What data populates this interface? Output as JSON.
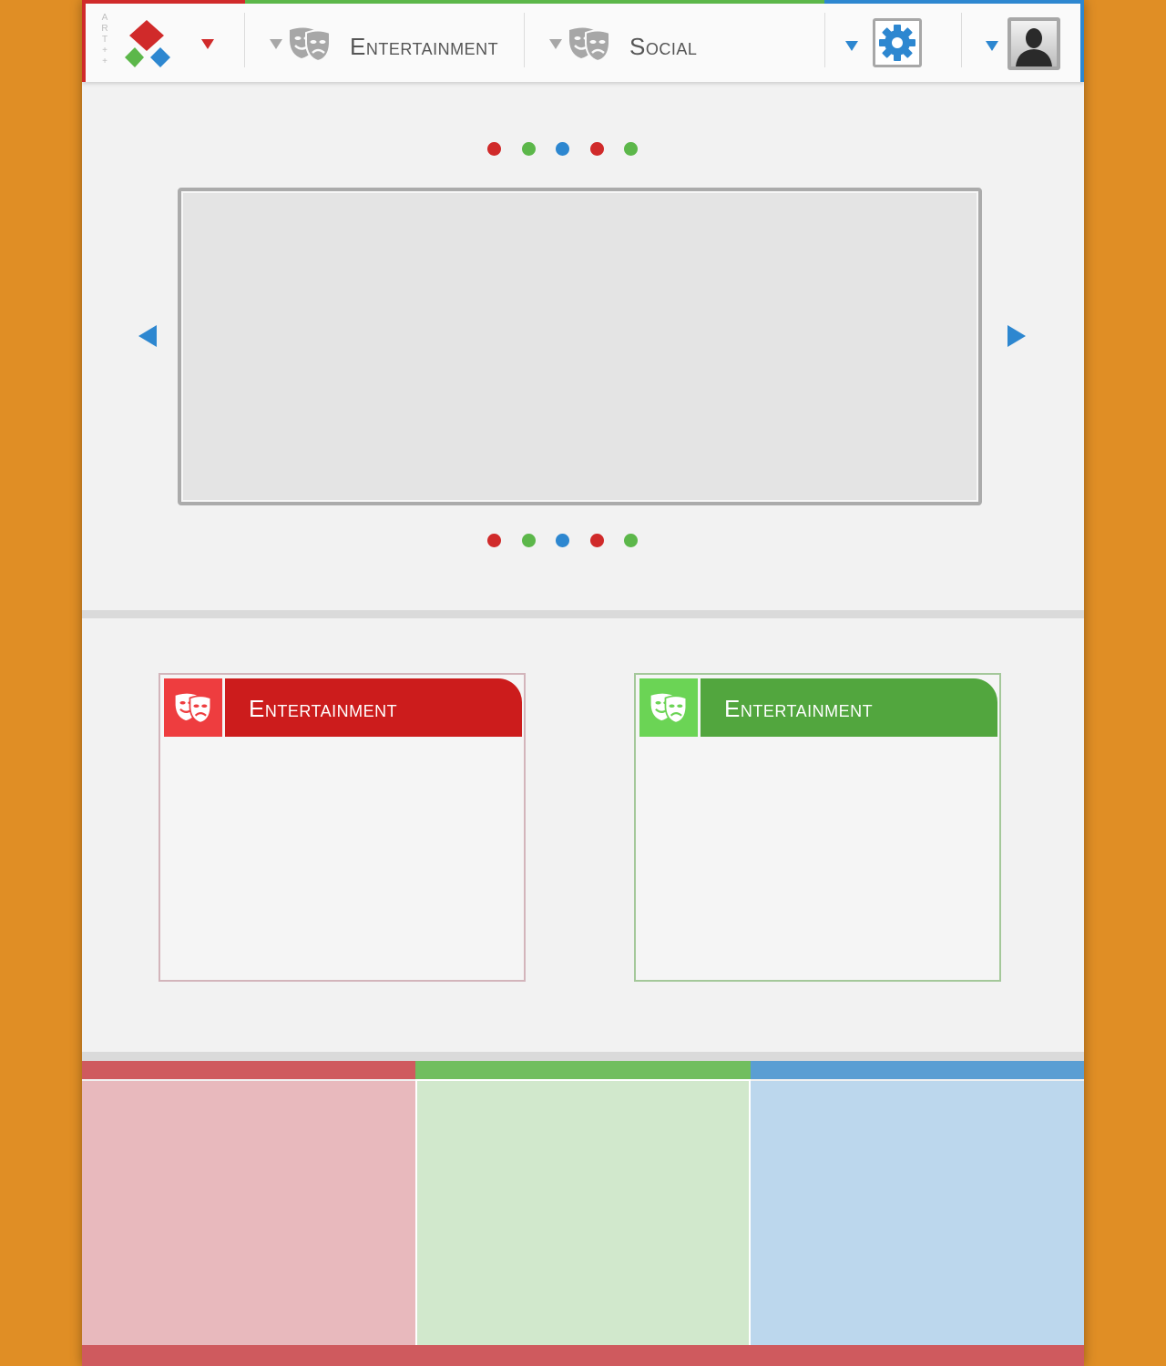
{
  "header": {
    "brand_vertical": "A\nR\nT\n+\n+",
    "nav": [
      {
        "label": "Entertainment",
        "icon": "theater-masks-icon"
      },
      {
        "label": "Social",
        "icon": "theater-masks-icon"
      }
    ],
    "settings_icon": "gear-icon",
    "profile_icon": "user-silhouette-icon"
  },
  "colors": {
    "red": "#d02a2a",
    "green": "#5cb74a",
    "blue": "#2d87d0",
    "background": "#e08e25"
  },
  "slider": {
    "pager_dots": [
      "red",
      "green",
      "blue",
      "red",
      "green"
    ],
    "prev_icon": "arrow-left-icon",
    "next_icon": "arrow-right-icon"
  },
  "cards": [
    {
      "title": "Entertainment",
      "color": "red",
      "icon": "theater-masks-icon"
    },
    {
      "title": "Entertainment",
      "color": "green",
      "icon": "theater-masks-icon"
    }
  ]
}
